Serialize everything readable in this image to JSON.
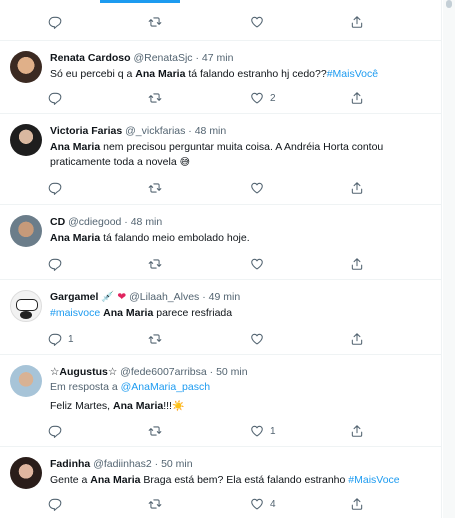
{
  "colors": {
    "accent": "#1d9bf0",
    "muted": "#536471",
    "text": "#0f1419",
    "heart_red": "#e0245e"
  },
  "top_row": {
    "icons": [
      "reply-icon",
      "retweet-icon",
      "like-icon",
      "share-icon"
    ]
  },
  "tweets": [
    {
      "name": "Renata Cardoso",
      "handle": "@RenataSjc",
      "time": "47 min",
      "text_pre": "Só eu percebi q a ",
      "bold": "Ana Maria",
      "text_post": " tá falando estranho hj cedo??",
      "hashtag": "#MaisVocê",
      "reply_count": "",
      "retweet_count": "",
      "like_count": "2"
    },
    {
      "name": "Victoria Farias",
      "handle": "@_vickfarias",
      "time": "48 min",
      "bold": "Ana Maria",
      "text_post_line1": " nem precisou perguntar muita coisa. A Andréia Horta contou",
      "text_line2": "praticamente toda a novela",
      "emoji": "😅",
      "like_count": ""
    },
    {
      "name": "CD",
      "handle": "@cdiegood",
      "time": "48 min",
      "bold": "Ana Maria",
      "text_post": " tá falando meio embolado hoje."
    },
    {
      "name": "Gargamel",
      "name_emoji": "💉",
      "heart": "❤",
      "handle": "@Lilaah_Alves",
      "time": "49 min",
      "hashtag": "#maisvoce",
      "bold": "Ana Maria",
      "text_post": " parece resfriada",
      "reply_count": "1"
    },
    {
      "name": "☆Augustus☆",
      "handle": "@fede6007arribsa",
      "time": "50 min",
      "reply_prefix": "Em resposta a ",
      "reply_to": "@AnaMaria_pasch",
      "text_pre": "Feliz Martes, ",
      "bold": "Ana Maria",
      "text_post": "!!!",
      "emoji": "☀️",
      "like_count": "1"
    },
    {
      "name": "Fadinha",
      "handle": "@fadiinhas2",
      "time": "50 min",
      "text_pre": "Gente a ",
      "bold": "Ana Maria",
      "text_post": " Braga está bem? Ela está falando estranho ",
      "hashtag": "#MaisVoce",
      "like_count": "4"
    }
  ]
}
